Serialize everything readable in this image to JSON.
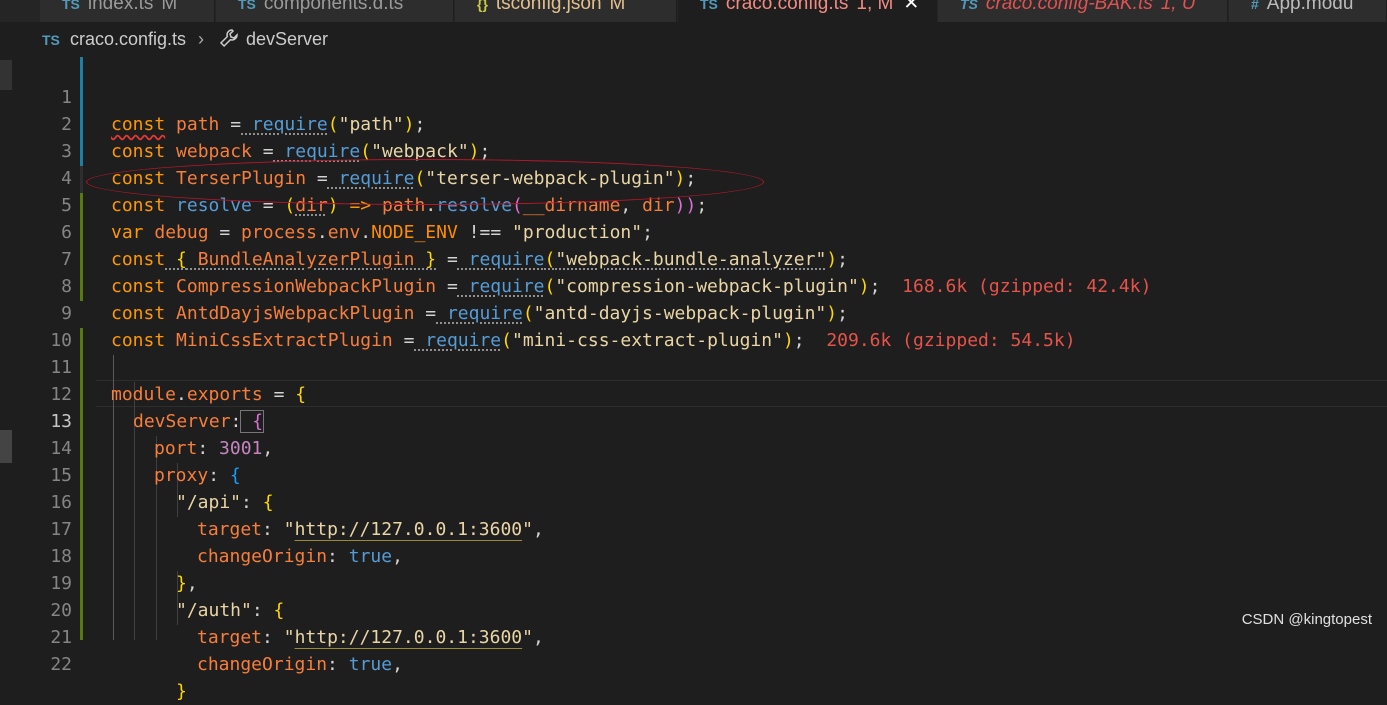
{
  "tabs": [
    {
      "name": "index.ts",
      "status": "M",
      "active": false
    },
    {
      "name": "components.d.ts",
      "status": "",
      "active": false
    },
    {
      "name": "tsconfig.json",
      "status": "M",
      "active": false
    },
    {
      "name": "craco.config.ts",
      "status": "1, M",
      "active": true
    },
    {
      "name": "craco.config-BAK.ts",
      "status": "1, U",
      "active": false
    },
    {
      "name": "App.modu",
      "status": "",
      "active": false
    }
  ],
  "breadcrumb": {
    "lang": "TS",
    "file": "craco.config.ts",
    "separator": "›",
    "symbol": "devServer",
    "symbol_icon": "wrench-icon"
  },
  "code": {
    "line1": {
      "n": "1",
      "t": [
        "const",
        " path ",
        "=",
        " require",
        "(",
        "\"path\"",
        ")",
        ";"
      ]
    },
    "line2": {
      "n": "2",
      "t": [
        "const",
        " webpack ",
        "=",
        " require",
        "(",
        "\"webpack\"",
        ")",
        ";"
      ]
    },
    "line3": {
      "n": "3",
      "t": [
        "const",
        " TerserPlugin ",
        "=",
        " require",
        "(",
        "\"terser-webpack-plugin\"",
        ")",
        ";"
      ]
    },
    "line4": {
      "n": "4",
      "t": [
        "const",
        " resolve ",
        "=",
        " (",
        "dir",
        ")",
        " =>",
        " path",
        ".",
        "resolve",
        "(",
        "__dirname",
        ", ",
        "dir",
        "))",
        ";"
      ]
    },
    "line5": {
      "n": "5",
      "t": [
        "var",
        " debug ",
        "=",
        " process",
        ".",
        "env",
        ".",
        "NODE_ENV",
        " !==",
        "\"production\"",
        ";"
      ]
    },
    "line6": {
      "n": "6",
      "t": [
        "const",
        " {",
        " BundleAnalyzerPlugin",
        " }",
        " =",
        " require",
        "(",
        "\"webpack-bundle-analyzer\"",
        ")",
        ";"
      ]
    },
    "line7": {
      "n": "7",
      "t": [
        "const",
        " CompressionWebpackPlugin ",
        "=",
        " require",
        "(",
        "\"compression-webpack-plugin\"",
        ")",
        ";"
      ],
      "size": "168.6k (gzipped: 42.4k)"
    },
    "line8": {
      "n": "8",
      "t": [
        "const",
        " AntdDayjsWebpackPlugin ",
        "=",
        " require",
        "(",
        "\"antd-dayjs-webpack-plugin\"",
        ")",
        ";"
      ]
    },
    "line9": {
      "n": "9",
      "t": [
        "const",
        " MiniCssExtractPlugin ",
        "=",
        " require",
        "(",
        "\"mini-css-extract-plugin\"",
        ")",
        ";"
      ],
      "size": "209.6k (gzipped: 54.5k)"
    },
    "line10": {
      "n": "10"
    },
    "line11": {
      "n": "11",
      "t": [
        "module",
        ".",
        "exports",
        " =",
        " {"
      ]
    },
    "line12": {
      "n": "12",
      "t": [
        "devServer",
        ":",
        " {"
      ]
    },
    "line13": {
      "n": "13",
      "t": [
        "port",
        ":",
        " 3001",
        ","
      ]
    },
    "line14": {
      "n": "14",
      "t": [
        "proxy",
        ":",
        " {"
      ]
    },
    "line15": {
      "n": "15",
      "t": [
        "\"/api\"",
        ":",
        " {"
      ]
    },
    "line16": {
      "n": "16",
      "t": [
        "target",
        ":",
        " \"",
        "http://127.0.0.1:3600",
        "\"",
        ","
      ]
    },
    "line17": {
      "n": "17",
      "t": [
        "changeOrigin",
        ":",
        " true",
        ","
      ]
    },
    "line18": {
      "n": "18",
      "t": [
        "}",
        ","
      ]
    },
    "line19": {
      "n": "19",
      "t": [
        "\"/auth\"",
        ":",
        " {"
      ]
    },
    "line20": {
      "n": "20",
      "t": [
        "target",
        ":",
        " \"",
        "http://127.0.0.1:3600",
        "\"",
        ","
      ]
    },
    "line21": {
      "n": "21",
      "t": [
        "changeOrigin",
        ":",
        " true",
        ","
      ]
    },
    "line22": {
      "n": "22",
      "t": [
        "}"
      ]
    }
  },
  "watermark": "CSDN @kingtopest"
}
